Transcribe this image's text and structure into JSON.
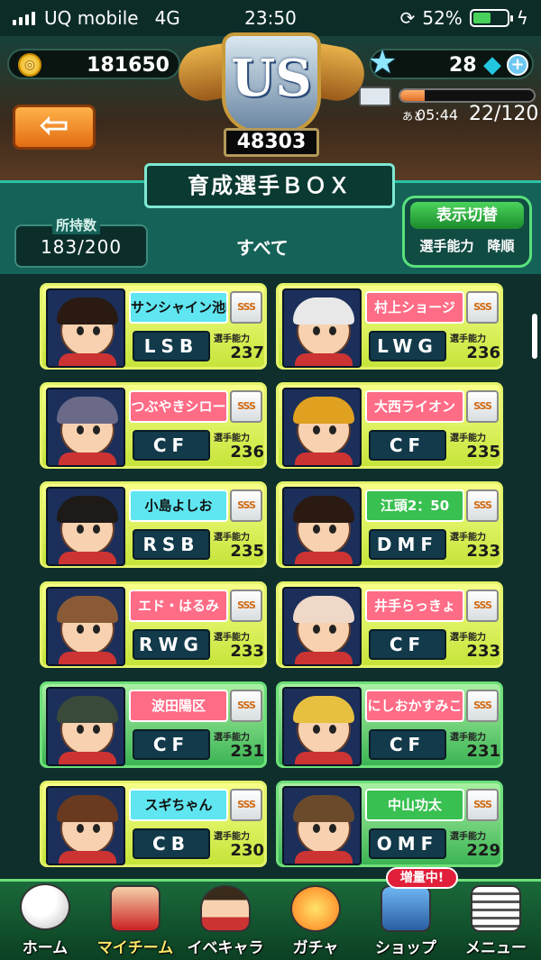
{
  "status": {
    "carrier": "UQ mobile",
    "network": "4G",
    "time": "23:50",
    "battery": "52%"
  },
  "header": {
    "coins": "181650",
    "stars": "28",
    "rank_emblem": "US",
    "rank_points": "48303",
    "stamina_prefix": "あと",
    "stamina_timer": "05:44",
    "stamina_count": "22/120",
    "stamina_fill": 0.18
  },
  "title": "育成選手ＢＯＸ",
  "owned": {
    "label": "所持数",
    "value": "183/200"
  },
  "filter_label": "すべて",
  "toggle": {
    "label": "表示切替",
    "sort": "選手能力　降順"
  },
  "ability_label": "選手能力",
  "rank_badge": "SSS",
  "players": [
    {
      "name": "サンシャイン池崎",
      "position": "LSB",
      "ability": "237",
      "plate": "cyan",
      "card": "yellow",
      "hair": "#2a1a12"
    },
    {
      "name": "村上ショージ",
      "position": "LWG",
      "ability": "236",
      "plate": "pink",
      "card": "yellow",
      "hair": "#e8e8e8"
    },
    {
      "name": "つぶやきシロー",
      "position": "CF",
      "ability": "236",
      "plate": "pink",
      "card": "yellow",
      "hair": "#6a6a88"
    },
    {
      "name": "大西ライオン",
      "position": "CF",
      "ability": "235",
      "plate": "pink",
      "card": "yellow",
      "hair": "#e0a020"
    },
    {
      "name": "小島よしお",
      "position": "RSB",
      "ability": "235",
      "plate": "cyan",
      "card": "yellow",
      "hair": "#1e1a18"
    },
    {
      "name": "江頭2：50",
      "position": "DMF",
      "ability": "233",
      "plate": "green",
      "card": "yellow",
      "hair": "#2a1a12"
    },
    {
      "name": "エド・はるみ",
      "position": "RWG",
      "ability": "233",
      "plate": "pink",
      "card": "yellow",
      "hair": "#8a5a36"
    },
    {
      "name": "井手らっきょ",
      "position": "CF",
      "ability": "233",
      "plate": "pink",
      "card": "yellow",
      "hair": "#f0d8c8"
    },
    {
      "name": "波田陽区",
      "position": "CF",
      "ability": "231",
      "plate": "pink",
      "card": "green",
      "hair": "#3a4a3a"
    },
    {
      "name": "にしおかすみこ",
      "position": "CF",
      "ability": "231",
      "plate": "pink",
      "card": "green",
      "hair": "#e8c040"
    },
    {
      "name": "スギちゃん",
      "position": "CB",
      "ability": "230",
      "plate": "cyan",
      "card": "yellow",
      "hair": "#6a3a20"
    },
    {
      "name": "中山功太",
      "position": "OMF",
      "ability": "229",
      "plate": "green",
      "card": "green",
      "hair": "#6a4a2a"
    }
  ],
  "nav": {
    "home": "ホーム",
    "myteam": "マイチーム",
    "event_chara": "イベキャラ",
    "gacha": "ガチャ",
    "shop": "ショップ",
    "shop_badge": "増量中!",
    "menu": "メニュー"
  },
  "colors": {
    "accent": "#2ac2a8",
    "card_yellow": "#e4f36a",
    "card_green": "#6ee07a",
    "back_button": "#e36d12"
  },
  "icons": [
    "coin-icon",
    "star-icon",
    "gem-icon",
    "plus-icon",
    "back-arrow-icon",
    "stamina-icon",
    "soccer-ball-icon",
    "team-icon",
    "chara-icon",
    "gacha-icon",
    "shop-icon",
    "menu-icon"
  ]
}
